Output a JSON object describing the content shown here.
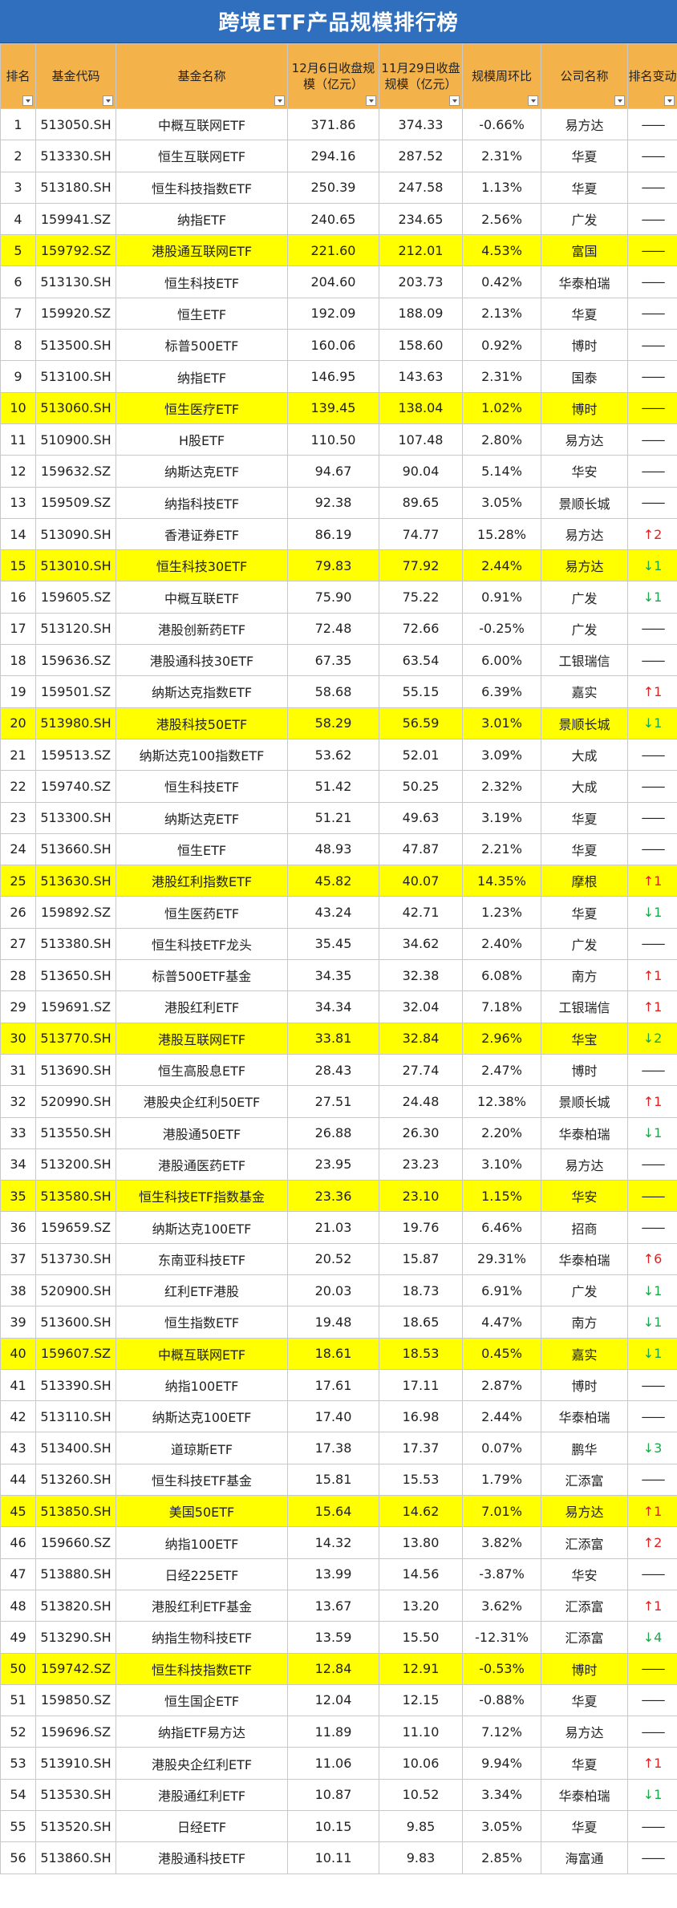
{
  "title": "跨境ETF产品规模排行榜",
  "headers": {
    "rank": "排名",
    "code": "基金代码",
    "name": "基金名称",
    "dec6": "12月6日收盘规模（亿元）",
    "nov29": "11月29日收盘规模（亿元）",
    "wow": "规模周环比",
    "company": "公司名称",
    "change": "排名变动"
  },
  "rows": [
    {
      "rank": "1",
      "code": "513050.SH",
      "name": "中概互联网ETF",
      "dec6": "371.86",
      "nov29": "374.33",
      "wow": "-0.66%",
      "company": "易方达",
      "change": "——",
      "dir": "none",
      "hl": false
    },
    {
      "rank": "2",
      "code": "513330.SH",
      "name": "恒生互联网ETF",
      "dec6": "294.16",
      "nov29": "287.52",
      "wow": "2.31%",
      "company": "华夏",
      "change": "——",
      "dir": "none",
      "hl": false
    },
    {
      "rank": "3",
      "code": "513180.SH",
      "name": "恒生科技指数ETF",
      "dec6": "250.39",
      "nov29": "247.58",
      "wow": "1.13%",
      "company": "华夏",
      "change": "——",
      "dir": "none",
      "hl": false
    },
    {
      "rank": "4",
      "code": "159941.SZ",
      "name": "纳指ETF",
      "dec6": "240.65",
      "nov29": "234.65",
      "wow": "2.56%",
      "company": "广发",
      "change": "——",
      "dir": "none",
      "hl": false
    },
    {
      "rank": "5",
      "code": "159792.SZ",
      "name": "港股通互联网ETF",
      "dec6": "221.60",
      "nov29": "212.01",
      "wow": "4.53%",
      "company": "富国",
      "change": "——",
      "dir": "none",
      "hl": true
    },
    {
      "rank": "6",
      "code": "513130.SH",
      "name": "恒生科技ETF",
      "dec6": "204.60",
      "nov29": "203.73",
      "wow": "0.42%",
      "company": "华泰柏瑞",
      "change": "——",
      "dir": "none",
      "hl": false
    },
    {
      "rank": "7",
      "code": "159920.SZ",
      "name": "恒生ETF",
      "dec6": "192.09",
      "nov29": "188.09",
      "wow": "2.13%",
      "company": "华夏",
      "change": "——",
      "dir": "none",
      "hl": false
    },
    {
      "rank": "8",
      "code": "513500.SH",
      "name": "标普500ETF",
      "dec6": "160.06",
      "nov29": "158.60",
      "wow": "0.92%",
      "company": "博时",
      "change": "——",
      "dir": "none",
      "hl": false
    },
    {
      "rank": "9",
      "code": "513100.SH",
      "name": "纳指ETF",
      "dec6": "146.95",
      "nov29": "143.63",
      "wow": "2.31%",
      "company": "国泰",
      "change": "——",
      "dir": "none",
      "hl": false
    },
    {
      "rank": "10",
      "code": "513060.SH",
      "name": "恒生医疗ETF",
      "dec6": "139.45",
      "nov29": "138.04",
      "wow": "1.02%",
      "company": "博时",
      "change": "——",
      "dir": "none",
      "hl": true
    },
    {
      "rank": "11",
      "code": "510900.SH",
      "name": "H股ETF",
      "dec6": "110.50",
      "nov29": "107.48",
      "wow": "2.80%",
      "company": "易方达",
      "change": "——",
      "dir": "none",
      "hl": false
    },
    {
      "rank": "12",
      "code": "159632.SZ",
      "name": "纳斯达克ETF",
      "dec6": "94.67",
      "nov29": "90.04",
      "wow": "5.14%",
      "company": "华安",
      "change": "——",
      "dir": "none",
      "hl": false
    },
    {
      "rank": "13",
      "code": "159509.SZ",
      "name": "纳指科技ETF",
      "dec6": "92.38",
      "nov29": "89.65",
      "wow": "3.05%",
      "company": "景顺长城",
      "change": "——",
      "dir": "none",
      "hl": false
    },
    {
      "rank": "14",
      "code": "513090.SH",
      "name": "香港证券ETF",
      "dec6": "86.19",
      "nov29": "74.77",
      "wow": "15.28%",
      "company": "易方达",
      "change": "↑2",
      "dir": "up",
      "hl": false
    },
    {
      "rank": "15",
      "code": "513010.SH",
      "name": "恒生科技30ETF",
      "dec6": "79.83",
      "nov29": "77.92",
      "wow": "2.44%",
      "company": "易方达",
      "change": "↓1",
      "dir": "down",
      "hl": true
    },
    {
      "rank": "16",
      "code": "159605.SZ",
      "name": "中概互联ETF",
      "dec6": "75.90",
      "nov29": "75.22",
      "wow": "0.91%",
      "company": "广发",
      "change": "↓1",
      "dir": "down",
      "hl": false
    },
    {
      "rank": "17",
      "code": "513120.SH",
      "name": "港股创新药ETF",
      "dec6": "72.48",
      "nov29": "72.66",
      "wow": "-0.25%",
      "company": "广发",
      "change": "——",
      "dir": "none",
      "hl": false
    },
    {
      "rank": "18",
      "code": "159636.SZ",
      "name": "港股通科技30ETF",
      "dec6": "67.35",
      "nov29": "63.54",
      "wow": "6.00%",
      "company": "工银瑞信",
      "change": "——",
      "dir": "none",
      "hl": false
    },
    {
      "rank": "19",
      "code": "159501.SZ",
      "name": "纳斯达克指数ETF",
      "dec6": "58.68",
      "nov29": "55.15",
      "wow": "6.39%",
      "company": "嘉实",
      "change": "↑1",
      "dir": "up",
      "hl": false
    },
    {
      "rank": "20",
      "code": "513980.SH",
      "name": "港股科技50ETF",
      "dec6": "58.29",
      "nov29": "56.59",
      "wow": "3.01%",
      "company": "景顺长城",
      "change": "↓1",
      "dir": "down",
      "hl": true
    },
    {
      "rank": "21",
      "code": "159513.SZ",
      "name": "纳斯达克100指数ETF",
      "dec6": "53.62",
      "nov29": "52.01",
      "wow": "3.09%",
      "company": "大成",
      "change": "——",
      "dir": "none",
      "hl": false
    },
    {
      "rank": "22",
      "code": "159740.SZ",
      "name": "恒生科技ETF",
      "dec6": "51.42",
      "nov29": "50.25",
      "wow": "2.32%",
      "company": "大成",
      "change": "——",
      "dir": "none",
      "hl": false
    },
    {
      "rank": "23",
      "code": "513300.SH",
      "name": "纳斯达克ETF",
      "dec6": "51.21",
      "nov29": "49.63",
      "wow": "3.19%",
      "company": "华夏",
      "change": "——",
      "dir": "none",
      "hl": false
    },
    {
      "rank": "24",
      "code": "513660.SH",
      "name": "恒生ETF",
      "dec6": "48.93",
      "nov29": "47.87",
      "wow": "2.21%",
      "company": "华夏",
      "change": "——",
      "dir": "none",
      "hl": false
    },
    {
      "rank": "25",
      "code": "513630.SH",
      "name": "港股红利指数ETF",
      "dec6": "45.82",
      "nov29": "40.07",
      "wow": "14.35%",
      "company": "摩根",
      "change": "↑1",
      "dir": "up",
      "hl": true
    },
    {
      "rank": "26",
      "code": "159892.SZ",
      "name": "恒生医药ETF",
      "dec6": "43.24",
      "nov29": "42.71",
      "wow": "1.23%",
      "company": "华夏",
      "change": "↓1",
      "dir": "down",
      "hl": false
    },
    {
      "rank": "27",
      "code": "513380.SH",
      "name": "恒生科技ETF龙头",
      "dec6": "35.45",
      "nov29": "34.62",
      "wow": "2.40%",
      "company": "广发",
      "change": "——",
      "dir": "none",
      "hl": false
    },
    {
      "rank": "28",
      "code": "513650.SH",
      "name": "标普500ETF基金",
      "dec6": "34.35",
      "nov29": "32.38",
      "wow": "6.08%",
      "company": "南方",
      "change": "↑1",
      "dir": "up",
      "hl": false
    },
    {
      "rank": "29",
      "code": "159691.SZ",
      "name": "港股红利ETF",
      "dec6": "34.34",
      "nov29": "32.04",
      "wow": "7.18%",
      "company": "工银瑞信",
      "change": "↑1",
      "dir": "up",
      "hl": false
    },
    {
      "rank": "30",
      "code": "513770.SH",
      "name": "港股互联网ETF",
      "dec6": "33.81",
      "nov29": "32.84",
      "wow": "2.96%",
      "company": "华宝",
      "change": "↓2",
      "dir": "down",
      "hl": true
    },
    {
      "rank": "31",
      "code": "513690.SH",
      "name": "恒生高股息ETF",
      "dec6": "28.43",
      "nov29": "27.74",
      "wow": "2.47%",
      "company": "博时",
      "change": "——",
      "dir": "none",
      "hl": false
    },
    {
      "rank": "32",
      "code": "520990.SH",
      "name": "港股央企红利50ETF",
      "dec6": "27.51",
      "nov29": "24.48",
      "wow": "12.38%",
      "company": "景顺长城",
      "change": "↑1",
      "dir": "up",
      "hl": false
    },
    {
      "rank": "33",
      "code": "513550.SH",
      "name": "港股通50ETF",
      "dec6": "26.88",
      "nov29": "26.30",
      "wow": "2.20%",
      "company": "华泰柏瑞",
      "change": "↓1",
      "dir": "down",
      "hl": false
    },
    {
      "rank": "34",
      "code": "513200.SH",
      "name": "港股通医药ETF",
      "dec6": "23.95",
      "nov29": "23.23",
      "wow": "3.10%",
      "company": "易方达",
      "change": "——",
      "dir": "none",
      "hl": false
    },
    {
      "rank": "35",
      "code": "513580.SH",
      "name": "恒生科技ETF指数基金",
      "dec6": "23.36",
      "nov29": "23.10",
      "wow": "1.15%",
      "company": "华安",
      "change": "——",
      "dir": "none",
      "hl": true
    },
    {
      "rank": "36",
      "code": "159659.SZ",
      "name": "纳斯达克100ETF",
      "dec6": "21.03",
      "nov29": "19.76",
      "wow": "6.46%",
      "company": "招商",
      "change": "——",
      "dir": "none",
      "hl": false
    },
    {
      "rank": "37",
      "code": "513730.SH",
      "name": "东南亚科技ETF",
      "dec6": "20.52",
      "nov29": "15.87",
      "wow": "29.31%",
      "company": "华泰柏瑞",
      "change": "↑6",
      "dir": "up",
      "hl": false
    },
    {
      "rank": "38",
      "code": "520900.SH",
      "name": "红利ETF港股",
      "dec6": "20.03",
      "nov29": "18.73",
      "wow": "6.91%",
      "company": "广发",
      "change": "↓1",
      "dir": "down",
      "hl": false
    },
    {
      "rank": "39",
      "code": "513600.SH",
      "name": "恒生指数ETF",
      "dec6": "19.48",
      "nov29": "18.65",
      "wow": "4.47%",
      "company": "南方",
      "change": "↓1",
      "dir": "down",
      "hl": false
    },
    {
      "rank": "40",
      "code": "159607.SZ",
      "name": "中概互联网ETF",
      "dec6": "18.61",
      "nov29": "18.53",
      "wow": "0.45%",
      "company": "嘉实",
      "change": "↓1",
      "dir": "down",
      "hl": true
    },
    {
      "rank": "41",
      "code": "513390.SH",
      "name": "纳指100ETF",
      "dec6": "17.61",
      "nov29": "17.11",
      "wow": "2.87%",
      "company": "博时",
      "change": "——",
      "dir": "none",
      "hl": false
    },
    {
      "rank": "42",
      "code": "513110.SH",
      "name": "纳斯达克100ETF",
      "dec6": "17.40",
      "nov29": "16.98",
      "wow": "2.44%",
      "company": "华泰柏瑞",
      "change": "——",
      "dir": "none",
      "hl": false
    },
    {
      "rank": "43",
      "code": "513400.SH",
      "name": "道琼斯ETF",
      "dec6": "17.38",
      "nov29": "17.37",
      "wow": "0.07%",
      "company": "鹏华",
      "change": "↓3",
      "dir": "down",
      "hl": false
    },
    {
      "rank": "44",
      "code": "513260.SH",
      "name": "恒生科技ETF基金",
      "dec6": "15.81",
      "nov29": "15.53",
      "wow": "1.79%",
      "company": "汇添富",
      "change": "——",
      "dir": "none",
      "hl": false
    },
    {
      "rank": "45",
      "code": "513850.SH",
      "name": "美国50ETF",
      "dec6": "15.64",
      "nov29": "14.62",
      "wow": "7.01%",
      "company": "易方达",
      "change": "↑1",
      "dir": "up",
      "hl": true
    },
    {
      "rank": "46",
      "code": "159660.SZ",
      "name": "纳指100ETF",
      "dec6": "14.32",
      "nov29": "13.80",
      "wow": "3.82%",
      "company": "汇添富",
      "change": "↑2",
      "dir": "up",
      "hl": false
    },
    {
      "rank": "47",
      "code": "513880.SH",
      "name": "日经225ETF",
      "dec6": "13.99",
      "nov29": "14.56",
      "wow": "-3.87%",
      "company": "华安",
      "change": "——",
      "dir": "none",
      "hl": false
    },
    {
      "rank": "48",
      "code": "513820.SH",
      "name": "港股红利ETF基金",
      "dec6": "13.67",
      "nov29": "13.20",
      "wow": "3.62%",
      "company": "汇添富",
      "change": "↑1",
      "dir": "up",
      "hl": false
    },
    {
      "rank": "49",
      "code": "513290.SH",
      "name": "纳指生物科技ETF",
      "dec6": "13.59",
      "nov29": "15.50",
      "wow": "-12.31%",
      "company": "汇添富",
      "change": "↓4",
      "dir": "down",
      "hl": false
    },
    {
      "rank": "50",
      "code": "159742.SZ",
      "name": "恒生科技指数ETF",
      "dec6": "12.84",
      "nov29": "12.91",
      "wow": "-0.53%",
      "company": "博时",
      "change": "——",
      "dir": "none",
      "hl": true
    },
    {
      "rank": "51",
      "code": "159850.SZ",
      "name": "恒生国企ETF",
      "dec6": "12.04",
      "nov29": "12.15",
      "wow": "-0.88%",
      "company": "华夏",
      "change": "——",
      "dir": "none",
      "hl": false
    },
    {
      "rank": "52",
      "code": "159696.SZ",
      "name": "纳指ETF易方达",
      "dec6": "11.89",
      "nov29": "11.10",
      "wow": "7.12%",
      "company": "易方达",
      "change": "——",
      "dir": "none",
      "hl": false
    },
    {
      "rank": "53",
      "code": "513910.SH",
      "name": "港股央企红利ETF",
      "dec6": "11.06",
      "nov29": "10.06",
      "wow": "9.94%",
      "company": "华夏",
      "change": "↑1",
      "dir": "up",
      "hl": false
    },
    {
      "rank": "54",
      "code": "513530.SH",
      "name": "港股通红利ETF",
      "dec6": "10.87",
      "nov29": "10.52",
      "wow": "3.34%",
      "company": "华泰柏瑞",
      "change": "↓1",
      "dir": "down",
      "hl": false
    },
    {
      "rank": "55",
      "code": "513520.SH",
      "name": "日经ETF",
      "dec6": "10.15",
      "nov29": "9.85",
      "wow": "3.05%",
      "company": "华夏",
      "change": "——",
      "dir": "none",
      "hl": false
    },
    {
      "rank": "56",
      "code": "513860.SH",
      "name": "港股通科技ETF",
      "dec6": "10.11",
      "nov29": "9.83",
      "wow": "2.85%",
      "company": "海富通",
      "change": "——",
      "dir": "none",
      "hl": false
    }
  ],
  "colors": {
    "title_bg": "#2f6fbd",
    "header_bg": "#f3b34a",
    "highlight": "#ffff00",
    "up": "#e02020",
    "down": "#1aa84a"
  }
}
